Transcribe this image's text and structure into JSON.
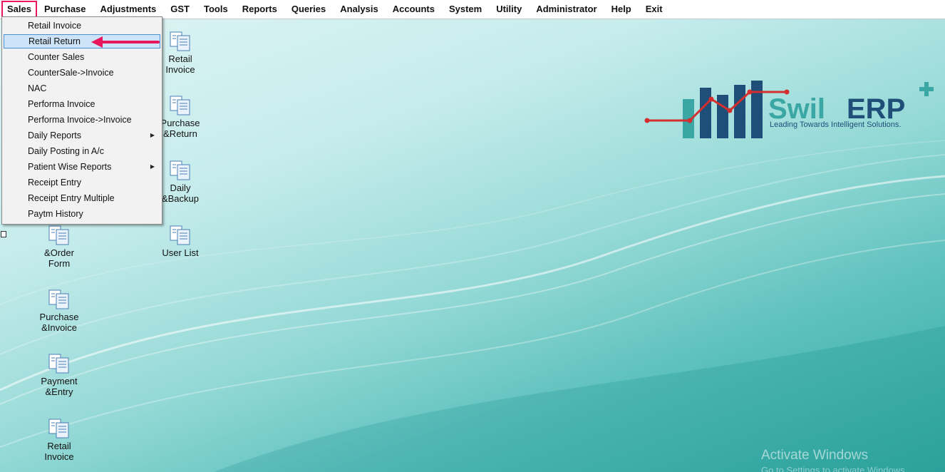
{
  "menubar": {
    "items": [
      "Sales",
      "Purchase",
      "Adjustments",
      "GST",
      "Tools",
      "Reports",
      "Queries",
      "Analysis",
      "Accounts",
      "System",
      "Utility",
      "Administrator",
      "Help",
      "Exit"
    ],
    "active": "Sales"
  },
  "sales_menu": {
    "items": [
      {
        "label": "Retail Invoice",
        "submenu": false
      },
      {
        "label": "Retail Return",
        "submenu": false,
        "highlighted": true
      },
      {
        "label": "Counter Sales",
        "submenu": false
      },
      {
        "label": "CounterSale->Invoice",
        "submenu": false
      },
      {
        "label": "NAC",
        "submenu": false
      },
      {
        "label": "Performa Invoice",
        "submenu": false
      },
      {
        "label": "Performa Invoice->Invoice",
        "submenu": false
      },
      {
        "label": "Daily Reports",
        "submenu": true
      },
      {
        "label": "Daily Posting in A/c",
        "submenu": false
      },
      {
        "label": "Patient Wise Reports",
        "submenu": true
      },
      {
        "label": "Receipt Entry",
        "submenu": false
      },
      {
        "label": "Receipt Entry Multiple",
        "submenu": false
      },
      {
        "label": "Paytm History",
        "submenu": false
      }
    ]
  },
  "desktop_icons": {
    "col1": [
      {
        "line1": "&Order",
        "line2": "Form"
      },
      {
        "line1": "Purchase",
        "line2": "&Invoice"
      },
      {
        "line1": "Payment",
        "line2": "&Entry"
      },
      {
        "line1": "Retail",
        "line2": "Invoice"
      }
    ],
    "col2": [
      {
        "line1": "Retail",
        "line2": "Invoice"
      },
      {
        "line1": "Purchase",
        "line2": "&Return"
      },
      {
        "line1": "Daily",
        "line2": "&Backup"
      },
      {
        "line1": "User List",
        "line2": ""
      }
    ]
  },
  "logo": {
    "brand_prefix": "Swil",
    "brand_suffix": "ERP",
    "tagline": "Leading Towards Intelligent Solutions."
  },
  "watermark": {
    "line1": "Activate Windows",
    "line2": "Go to Settings to activate Windows."
  },
  "colors": {
    "accent_highlight": "#e8175d",
    "menu_highlight": "#cde3f7",
    "logo_teal": "#3aa7a5",
    "logo_navy": "#1f4e79",
    "logo_red": "#d32f2f"
  }
}
